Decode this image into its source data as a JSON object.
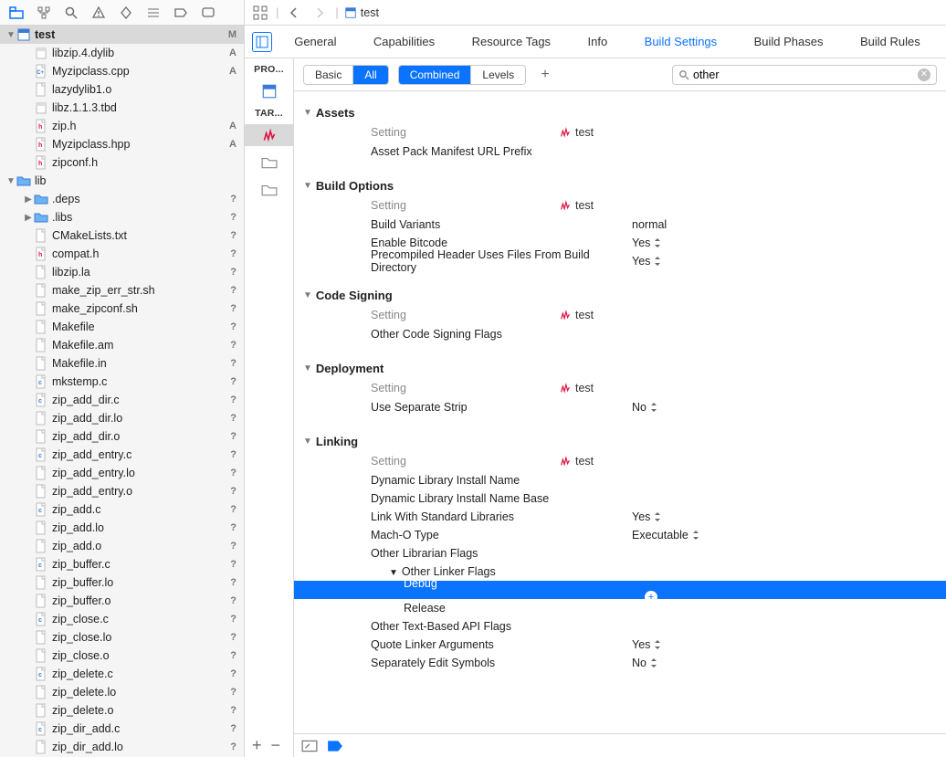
{
  "project_name": "test",
  "project_status": "M",
  "breadcrumb": {
    "label": "test"
  },
  "tree": [
    {
      "name": "libzip.4.dylib",
      "icon": "lib",
      "ind": 1,
      "status": "A"
    },
    {
      "name": "Myzipclass.cpp",
      "icon": "cpp",
      "ind": 1,
      "status": "A"
    },
    {
      "name": "lazydylib1.o",
      "icon": "obj",
      "ind": 1,
      "status": ""
    },
    {
      "name": "libz.1.1.3.tbd",
      "icon": "lib",
      "ind": 1,
      "status": ""
    },
    {
      "name": "zip.h",
      "icon": "h",
      "ind": 1,
      "status": "A"
    },
    {
      "name": "Myzipclass.hpp",
      "icon": "h",
      "ind": 1,
      "status": "A"
    },
    {
      "name": "zipconf.h",
      "icon": "h",
      "ind": 1,
      "status": ""
    },
    {
      "name": "lib",
      "icon": "folder",
      "ind": 0,
      "status": "",
      "disc": "▼"
    },
    {
      "name": ".deps",
      "icon": "folder",
      "ind": 1,
      "status": "?",
      "disc": "▶"
    },
    {
      "name": ".libs",
      "icon": "folder",
      "ind": 1,
      "status": "?",
      "disc": "▶"
    },
    {
      "name": "CMakeLists.txt",
      "icon": "txt",
      "ind": 1,
      "status": "?"
    },
    {
      "name": "compat.h",
      "icon": "h",
      "ind": 1,
      "status": "?"
    },
    {
      "name": "libzip.la",
      "icon": "txt",
      "ind": 1,
      "status": "?"
    },
    {
      "name": "make_zip_err_str.sh",
      "icon": "txt",
      "ind": 1,
      "status": "?"
    },
    {
      "name": "make_zipconf.sh",
      "icon": "txt",
      "ind": 1,
      "status": "?"
    },
    {
      "name": "Makefile",
      "icon": "txt",
      "ind": 1,
      "status": "?"
    },
    {
      "name": "Makefile.am",
      "icon": "txt",
      "ind": 1,
      "status": "?"
    },
    {
      "name": "Makefile.in",
      "icon": "txt",
      "ind": 1,
      "status": "?"
    },
    {
      "name": "mkstemp.c",
      "icon": "c",
      "ind": 1,
      "status": "?"
    },
    {
      "name": "zip_add_dir.c",
      "icon": "c",
      "ind": 1,
      "status": "?"
    },
    {
      "name": "zip_add_dir.lo",
      "icon": "txt",
      "ind": 1,
      "status": "?"
    },
    {
      "name": "zip_add_dir.o",
      "icon": "obj",
      "ind": 1,
      "status": "?"
    },
    {
      "name": "zip_add_entry.c",
      "icon": "c",
      "ind": 1,
      "status": "?"
    },
    {
      "name": "zip_add_entry.lo",
      "icon": "txt",
      "ind": 1,
      "status": "?"
    },
    {
      "name": "zip_add_entry.o",
      "icon": "obj",
      "ind": 1,
      "status": "?"
    },
    {
      "name": "zip_add.c",
      "icon": "c",
      "ind": 1,
      "status": "?"
    },
    {
      "name": "zip_add.lo",
      "icon": "txt",
      "ind": 1,
      "status": "?"
    },
    {
      "name": "zip_add.o",
      "icon": "obj",
      "ind": 1,
      "status": "?"
    },
    {
      "name": "zip_buffer.c",
      "icon": "c",
      "ind": 1,
      "status": "?"
    },
    {
      "name": "zip_buffer.lo",
      "icon": "txt",
      "ind": 1,
      "status": "?"
    },
    {
      "name": "zip_buffer.o",
      "icon": "obj",
      "ind": 1,
      "status": "?"
    },
    {
      "name": "zip_close.c",
      "icon": "c",
      "ind": 1,
      "status": "?"
    },
    {
      "name": "zip_close.lo",
      "icon": "txt",
      "ind": 1,
      "status": "?"
    },
    {
      "name": "zip_close.o",
      "icon": "obj",
      "ind": 1,
      "status": "?"
    },
    {
      "name": "zip_delete.c",
      "icon": "c",
      "ind": 1,
      "status": "?"
    },
    {
      "name": "zip_delete.lo",
      "icon": "txt",
      "ind": 1,
      "status": "?"
    },
    {
      "name": "zip_delete.o",
      "icon": "obj",
      "ind": 1,
      "status": "?"
    },
    {
      "name": "zip_dir_add.c",
      "icon": "c",
      "ind": 1,
      "status": "?"
    },
    {
      "name": "zip_dir_add.lo",
      "icon": "txt",
      "ind": 1,
      "status": "?"
    }
  ],
  "editor_tabs": [
    "General",
    "Capabilities",
    "Resource Tags",
    "Info",
    "Build Settings",
    "Build Phases",
    "Build Rules"
  ],
  "editor_active": 4,
  "targets": {
    "project_label": "PRO...",
    "targets_label": "TAR..."
  },
  "filter": {
    "seg1": [
      "Basic",
      "All"
    ],
    "seg2": [
      "Combined",
      "Levels"
    ],
    "search_value": "other"
  },
  "col_setting_label": "Setting",
  "col_target_label": "test",
  "sections": [
    {
      "title": "Assets",
      "rows": [
        {
          "label": "Asset Pack Manifest URL Prefix",
          "value": ""
        }
      ]
    },
    {
      "title": "Build Options",
      "rows": [
        {
          "label": "Build Variants",
          "value": "normal"
        },
        {
          "label": "Enable Bitcode",
          "value": "Yes",
          "step": true
        },
        {
          "label": "Precompiled Header Uses Files From Build Directory",
          "value": "Yes",
          "step": true
        }
      ]
    },
    {
      "title": "Code Signing",
      "rows": [
        {
          "label": "Other Code Signing Flags",
          "value": ""
        }
      ]
    },
    {
      "title": "Deployment",
      "rows": [
        {
          "label": "Use Separate Strip",
          "value": "No",
          "step": true
        }
      ]
    },
    {
      "title": "Linking",
      "rows": [
        {
          "label": "Dynamic Library Install Name",
          "value": ""
        },
        {
          "label": "Dynamic Library Install Name Base",
          "value": ""
        },
        {
          "label": "Link With Standard Libraries",
          "value": "Yes",
          "step": true
        },
        {
          "label": "Mach-O Type",
          "value": "Executable",
          "step": true
        },
        {
          "label": "Other Librarian Flags",
          "value": ""
        },
        {
          "label": "Other Linker Flags",
          "value": "",
          "disc": "▼",
          "sub": true
        },
        {
          "label": "Debug",
          "value": "",
          "selected": true,
          "sub2": true,
          "add": true
        },
        {
          "label": "Release",
          "value": "",
          "sub2": true
        },
        {
          "label": "Other Text-Based API Flags",
          "value": ""
        },
        {
          "label": "Quote Linker Arguments",
          "value": "Yes",
          "step": true
        },
        {
          "label": "Separately Edit Symbols",
          "value": "No",
          "step": true
        }
      ]
    }
  ]
}
